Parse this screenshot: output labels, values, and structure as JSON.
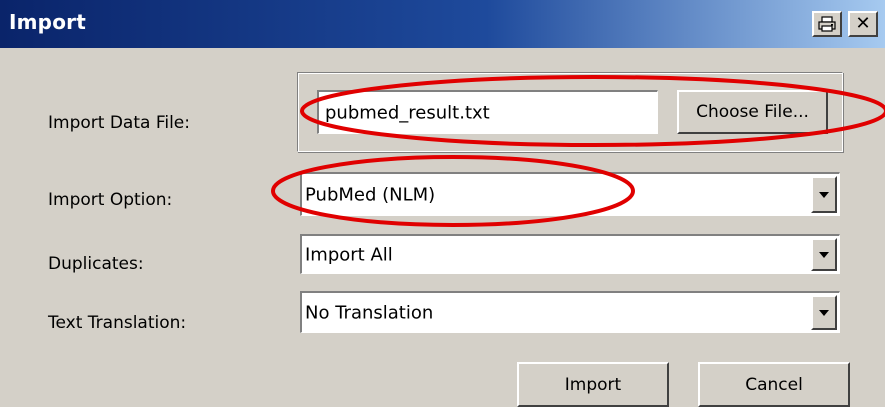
{
  "window": {
    "title": "Import"
  },
  "labels": {
    "import_data_file": "Import Data File:",
    "import_option": "Import Option:",
    "duplicates": "Duplicates:",
    "text_translation": "Text Translation:"
  },
  "file": {
    "value": "pubmed_result.txt",
    "choose_label": "Choose File..."
  },
  "import_option": {
    "selected": "PubMed (NLM)"
  },
  "duplicates": {
    "selected": "Import All"
  },
  "text_translation": {
    "selected": "No Translation"
  },
  "buttons": {
    "import": "Import",
    "cancel": "Cancel"
  },
  "annotation_color": "#e00000"
}
